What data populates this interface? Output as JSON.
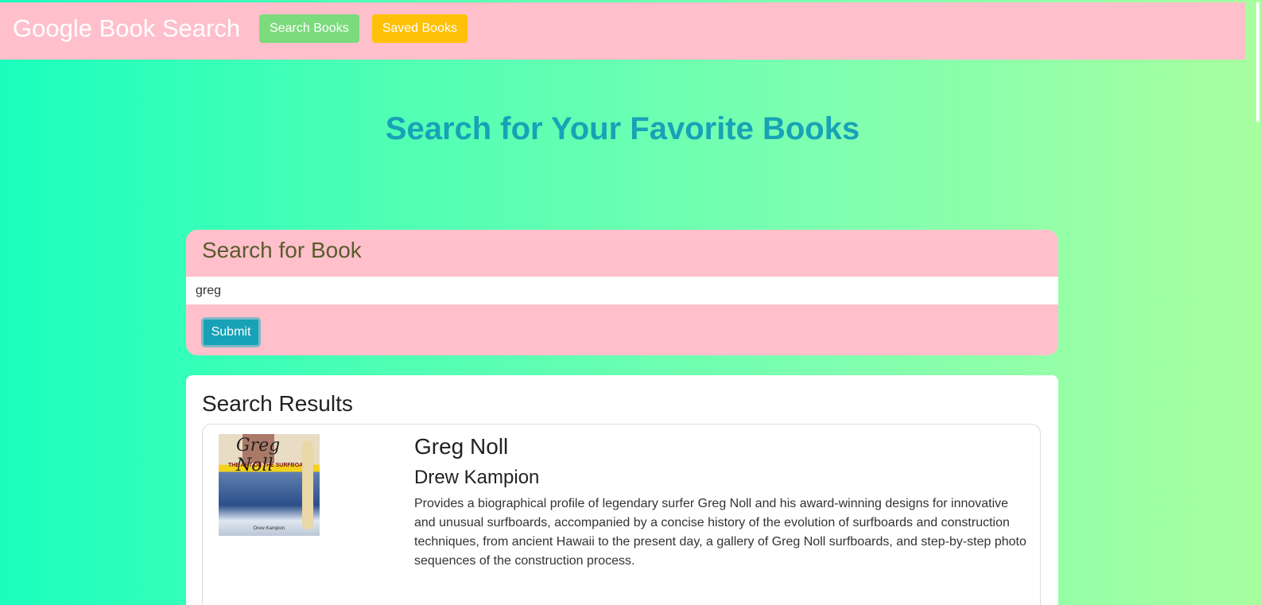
{
  "nav": {
    "brand": "Google Book Search",
    "search_label": "Search Books",
    "saved_label": "Saved Books"
  },
  "hero": {
    "title": "Search for Your Favorite Books"
  },
  "search": {
    "title": "Search for Book",
    "value": "greg",
    "submit_label": "Submit"
  },
  "results": {
    "title": "Search Results",
    "books": [
      {
        "title": "Greg Noll",
        "author": "Drew Kampion",
        "description": "Provides a biographical profile of legendary surfer Greg Noll and his award-winning designs for innovative and unusual surfboards, accompanied by a concise history of the evolution of surfboards and construction techniques, from ancient Hawaii to the present day, a gallery of Greg Noll surfboards, and step-by-step photo sequences of the construction process.",
        "cover": {
          "signature": "Greg Noll",
          "subtitle": "THE ART OF THE SURFBOARD",
          "author": "Drew Kampion"
        }
      }
    ]
  },
  "colors": {
    "navbar": "#ffc0cb",
    "accent": "#17a2b8",
    "nav_search": "#7cdb7c",
    "nav_saved": "#ffc107"
  }
}
